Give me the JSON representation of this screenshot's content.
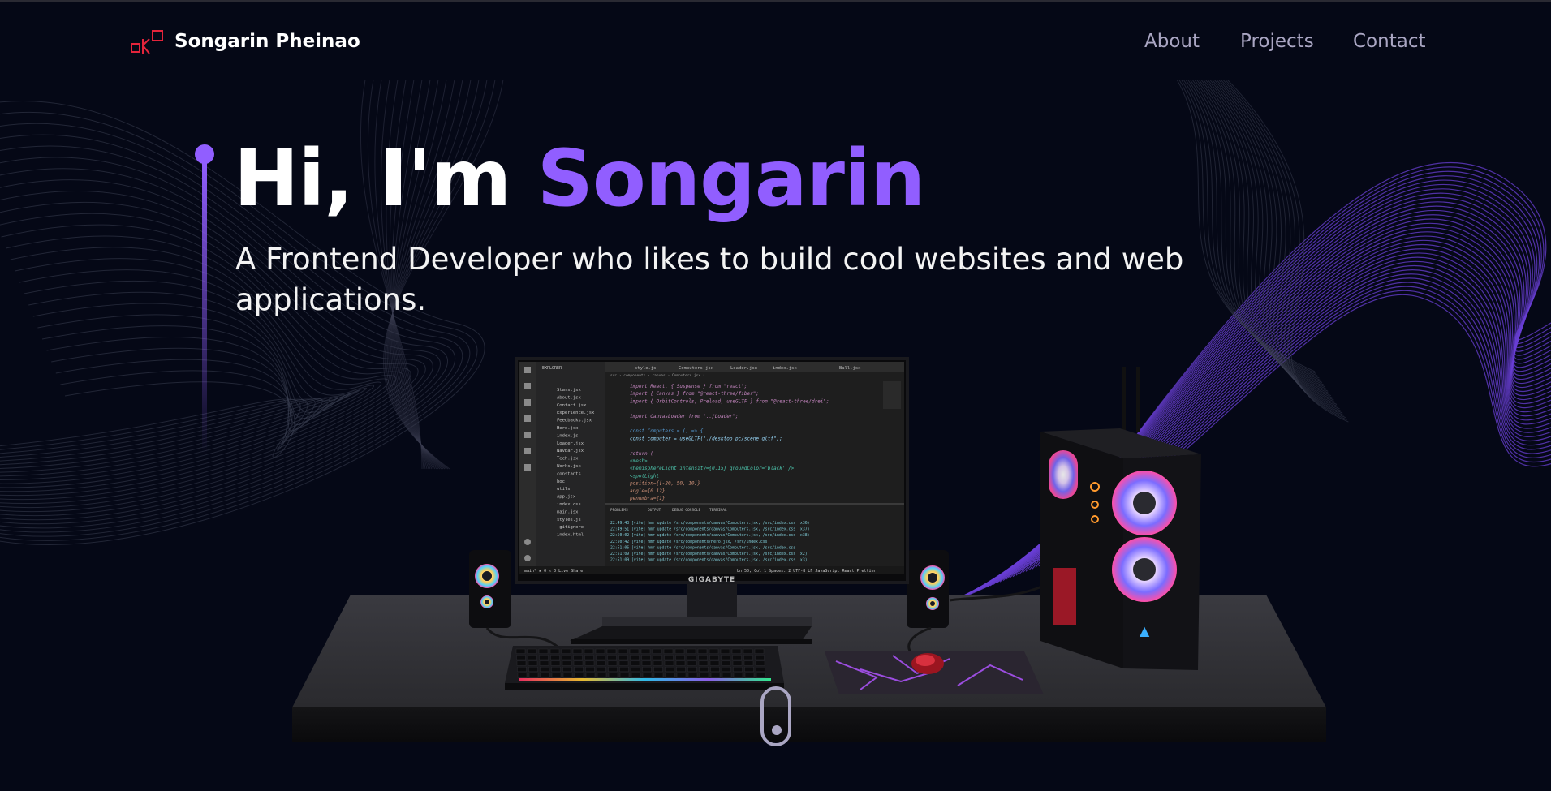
{
  "nav": {
    "brand": "Songarin Pheinao",
    "links": [
      "About",
      "Projects",
      "Contact"
    ]
  },
  "hero": {
    "greeting": "Hi, I'm ",
    "name": "Songarin",
    "subtitle": "A Frontend Developer who likes to build cool websites and web applications."
  },
  "monitor": {
    "brand": "GIGABYTE",
    "editor_tabs": [
      "style.js",
      "Computers.jsx",
      "Loader.jsx",
      "index.jsx",
      "Ball.jsx"
    ],
    "explorer_title": "EXPLORER",
    "files": [
      "Stars.jsx",
      "About.jsx",
      "Contact.jsx",
      "Experience.jsx",
      "Feedbacks.jsx",
      "Hero.jsx",
      "index.js",
      "Loader.jsx",
      "Navbar.jsx",
      "Tech.jsx",
      "Works.jsx",
      "constants",
      "hoc",
      "utils",
      "App.jsx",
      "index.css",
      "main.jsx",
      "styles.js",
      ".gitignore",
      "index.html"
    ],
    "code_lines": [
      "import React, { Suspense } from \"react\";",
      "import { Canvas } from \"@react-three/fiber\";",
      "import { OrbitControls, Preload, useGLTF } from \"@react-three/drei\";",
      "",
      "import CanvasLoader from \"../Loader\";",
      "",
      "const Computers = () => {",
      "  const computer = useGLTF(\"./desktop_pc/scene.gltf\");",
      "",
      "  return (",
      "    <mesh>",
      "      <hemisphereLight intensity={0.15} groundColor='black' />",
      "      <spotLight",
      "        position={[-20, 50, 10]}",
      "        angle={0.12}",
      "        penumbra={1}"
    ],
    "panel_tabs": [
      "PROBLEMS",
      "OUTPUT",
      "DEBUG CONSOLE",
      "TERMINAL"
    ],
    "terminal_lines": [
      "22:49:43 [vite] hmr update /src/components/canvas/Computers.jsx, /src/index.css (x36)",
      "22:49:51 [vite] hmr update /src/components/canvas/Computers.jsx, /src/index.css (x37)",
      "22:50:02 [vite] hmr update /src/components/canvas/Computers.jsx, /src/index.css (x38)",
      "22:50:42 [vite] hmr update /src/components/Hero.jsx, /src/index.css",
      "22:51:06 [vite] hmr update /src/components/canvas/Computers.jsx, /src/index.css",
      "22:51:09 [vite] hmr update /src/components/canvas/Computers.jsx, /src/index.css (x2)",
      "22:51:09 [vite] hmr update /src/components/canvas/Computers.jsx, /src/index.css (x3)"
    ],
    "status_left": "main*  ⊗ 0 ⚠ 0  Live Share",
    "status_right": "Ln 50, Col 1  Spaces: 2  UTF-8  LF  JavaScript React  Prettier"
  },
  "colors": {
    "background": "#050816",
    "accent": "#915eff",
    "secondary": "#aaa6c3",
    "white": "#ffffff",
    "logo_red": "#e4243b"
  },
  "icons": [
    "logo-icon",
    "scroll-indicator-icon"
  ]
}
